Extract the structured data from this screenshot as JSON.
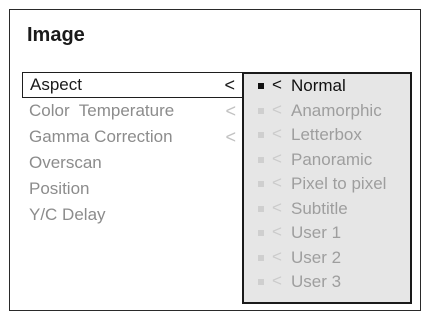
{
  "title": "Image",
  "menu": {
    "items": [
      {
        "label": "Aspect",
        "arrow": "<"
      },
      {
        "label": "Color  Temperature",
        "arrow": "<"
      },
      {
        "label": "Gamma Correction",
        "arrow": "<"
      },
      {
        "label": "Overscan"
      },
      {
        "label": "Position"
      },
      {
        "label": "Y/C Delay"
      }
    ],
    "selected_index": 0
  },
  "submenu": {
    "items": [
      {
        "label": "Normal",
        "arrow": "<"
      },
      {
        "label": "Anamorphic",
        "arrow": "<"
      },
      {
        "label": "Letterbox",
        "arrow": "<"
      },
      {
        "label": "Panoramic",
        "arrow": "<"
      },
      {
        "label": "Pixel to pixel",
        "arrow": "<"
      },
      {
        "label": "Subtitle",
        "arrow": "<"
      },
      {
        "label": "User 1",
        "arrow": "<"
      },
      {
        "label": "User 2",
        "arrow": "<"
      },
      {
        "label": "User 3",
        "arrow": "<"
      }
    ],
    "active_index": 0
  },
  "colors": {
    "frame_border": "#2a2a2a",
    "submenu_bg": "#e6e6e6",
    "active_text": "#1a1a1a",
    "inactive_text": "#8c8c8c"
  },
  "icons": {
    "menu_arrow": "chevron-left-icon",
    "bullet": "square-bullet-icon"
  }
}
